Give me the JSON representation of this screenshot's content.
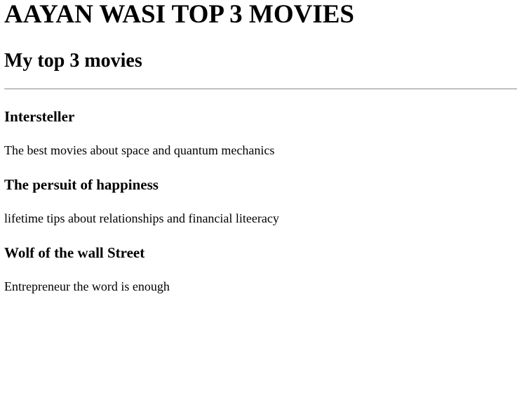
{
  "page": {
    "title": "AAYAN WASI TOP 3 MOVIES",
    "subtitle": "My top 3 movies"
  },
  "movies": [
    {
      "name": "Intersteller",
      "description": "The best movies about space and quantum mechanics"
    },
    {
      "name": "The persuit of happiness",
      "description": "lifetime tips about relationships and financial liteeracy"
    },
    {
      "name": "Wolf of the wall Street",
      "description": "Entrepreneur the word is enough"
    }
  ]
}
